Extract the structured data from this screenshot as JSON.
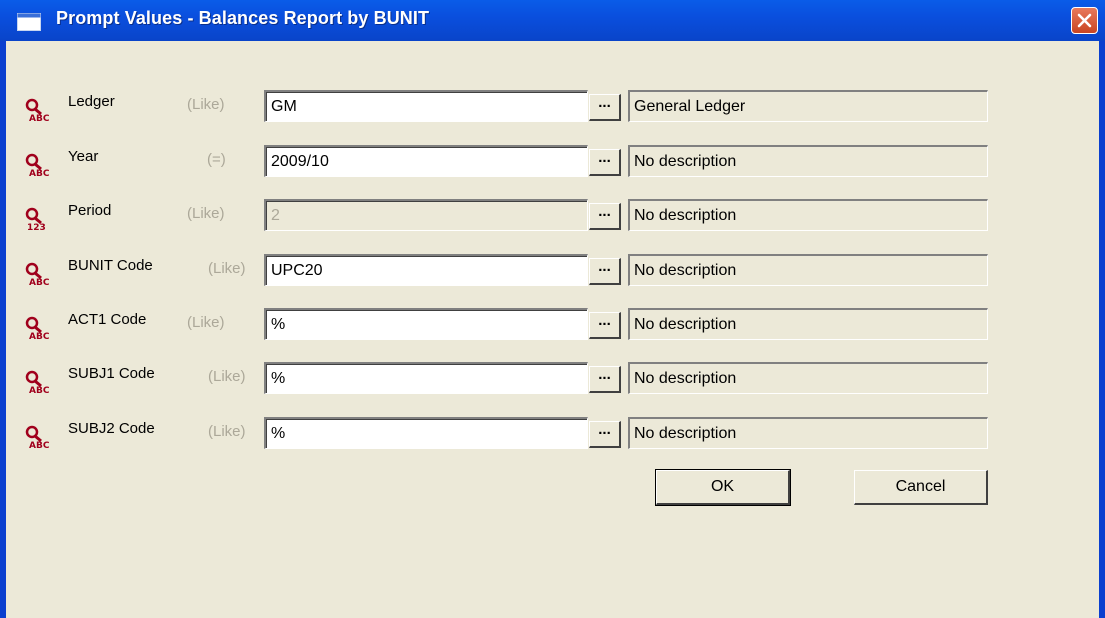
{
  "window": {
    "title": "Prompt Values - Balances Report by BUNIT"
  },
  "prompts": [
    {
      "label": "Ledger",
      "operator": "(Like)",
      "value": "GM",
      "description": "General Ledger",
      "icon": "abc-search-icon",
      "enabled": true
    },
    {
      "label": "Year",
      "operator": "(=)",
      "value": "2009/10",
      "description": "No description",
      "icon": "abc-search-icon",
      "enabled": true
    },
    {
      "label": "Period",
      "operator": "(Like)",
      "value": "2",
      "description": "No description",
      "icon": "123-search-icon",
      "enabled": false
    },
    {
      "label": "BUNIT Code",
      "operator": "(Like)",
      "value": "UPC20",
      "description": "No description",
      "icon": "abc-search-icon",
      "enabled": true
    },
    {
      "label": "ACT1 Code",
      "operator": "(Like)",
      "value": "%",
      "description": "No description",
      "icon": "abc-search-icon",
      "enabled": true
    },
    {
      "label": "SUBJ1 Code",
      "operator": "(Like)",
      "value": "%",
      "description": "No description",
      "icon": "abc-search-icon",
      "enabled": true
    },
    {
      "label": "SUBJ2 Code",
      "operator": "(Like)",
      "value": "%",
      "description": "No description",
      "icon": "abc-search-icon",
      "enabled": true
    }
  ],
  "browse_label": "...",
  "buttons": {
    "ok": "OK",
    "cancel": "Cancel"
  },
  "colors": {
    "titlebar": "#0a4fde",
    "face": "#ece9d8",
    "disabled_text": "#aca899",
    "icon_red": "#a0001c"
  }
}
